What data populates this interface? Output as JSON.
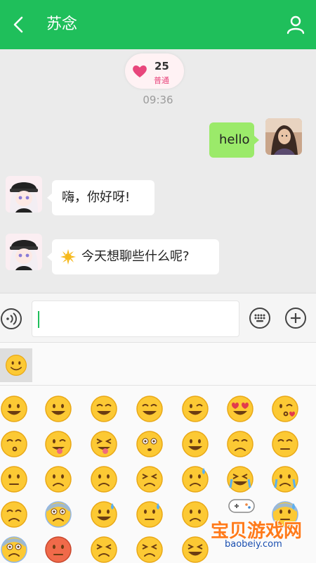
{
  "header": {
    "title": "苏念"
  },
  "intimacy": {
    "value": "25",
    "level": "普通"
  },
  "timestamp": "09:36",
  "messages": [
    {
      "from": "self",
      "text": "hello"
    },
    {
      "from": "other",
      "text": "嗨，你好呀!"
    },
    {
      "from": "other",
      "sticker": "sun-emoji",
      "text": "今天想聊些什么呢?"
    }
  ],
  "input": {
    "value": ""
  },
  "emoji_tabs": [
    "smiley-tab"
  ],
  "emoji_grid": [
    [
      "grinning-smile",
      "grinning",
      "smiling",
      "relaxed",
      "winking",
      "heart-eyes",
      "kissing-heart"
    ],
    [
      "kissing-smiling",
      "winking-tongue",
      "squint-tongue",
      "flushed",
      "grin",
      "pensive",
      "relieved"
    ],
    [
      "unamused",
      "worried",
      "disappointed",
      "confounded",
      "sad-sweat",
      "laughing-tears",
      "crying"
    ],
    [
      "sleepy",
      "fearful",
      "sweat-smile",
      "downcast-sweat",
      "tired",
      "",
      "cold-sweat"
    ],
    [
      "screaming",
      "angry",
      "persevering",
      "tired-face",
      "grin-squint",
      "",
      ""
    ]
  ],
  "watermark": {
    "text": "宝贝游戏网",
    "url": "baobeiy.com"
  },
  "colors": {
    "brand": "#1fbf5b",
    "self_bubble": "#9bea6a",
    "accent": "#e8467c"
  }
}
